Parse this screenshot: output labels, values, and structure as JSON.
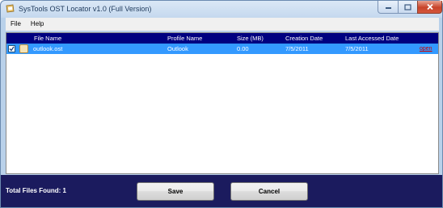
{
  "window": {
    "title": "SysTools OST Locator  v1.0 (Full Version)"
  },
  "menu": [
    {
      "label": "File"
    },
    {
      "label": "Help"
    }
  ],
  "table": {
    "columns": [
      "File Name",
      "Profile Name",
      "Size (MB)",
      "Creation Date",
      "Last Accessed Date"
    ],
    "rows": [
      {
        "checked": true,
        "file_name": "outlook.ost",
        "profile_name": "Outlook",
        "size_mb": "0.00",
        "creation_date": "7/5/2011",
        "last_accessed": "7/5/2011",
        "action": "open"
      }
    ]
  },
  "footer": {
    "total_label": "Total Files Found: 1",
    "save_label": "Save",
    "cancel_label": "Cancel"
  },
  "colors": {
    "header_bg": "#000080",
    "selected_row": "#3399ff",
    "footer_bg": "#1b1b5e",
    "link": "#cc0000"
  },
  "icons": {
    "app": "app-icon",
    "file": "ost-file-icon",
    "check": "checkmark-icon"
  }
}
